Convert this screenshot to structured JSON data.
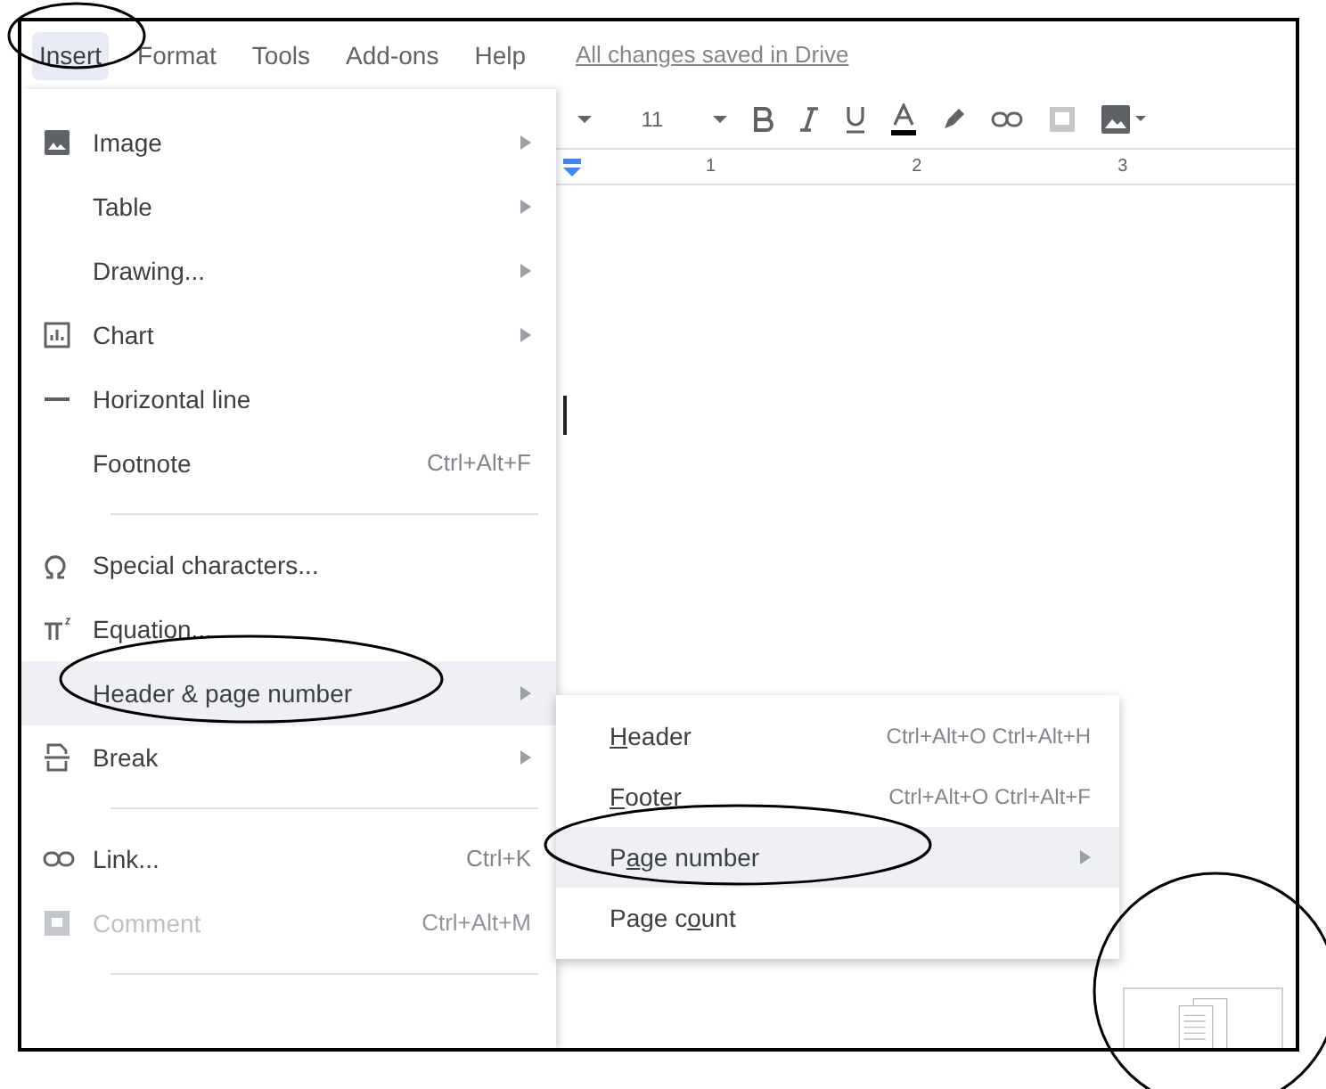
{
  "menubar": {
    "items": [
      {
        "label": "Insert",
        "selected": true
      },
      {
        "label": "Format",
        "selected": false
      },
      {
        "label": "Tools",
        "selected": false
      },
      {
        "label": "Add-ons",
        "selected": false
      },
      {
        "label": "Help",
        "selected": false
      }
    ],
    "status": "All changes saved in Drive"
  },
  "toolbar": {
    "font_size": "11"
  },
  "ruler": {
    "marks": [
      "1",
      "2",
      "3"
    ]
  },
  "insert_menu": [
    {
      "kind": "image",
      "label": "Image",
      "submenu": true,
      "selected": false,
      "disabled": false
    },
    {
      "kind": "plain",
      "label": "Table",
      "submenu": true,
      "selected": false,
      "disabled": false
    },
    {
      "kind": "plain",
      "label": "Drawing...",
      "submenu": true,
      "selected": false,
      "disabled": false
    },
    {
      "kind": "chart",
      "label": "Chart",
      "submenu": true,
      "selected": false,
      "disabled": false
    },
    {
      "kind": "line",
      "label": "Horizontal line",
      "submenu": false,
      "selected": false,
      "disabled": false
    },
    {
      "kind": "plain",
      "label": "Footnote",
      "shortcut": "Ctrl+Alt+F",
      "submenu": false,
      "selected": false,
      "disabled": false
    },
    {
      "kind": "separator"
    },
    {
      "kind": "omega",
      "label": "Special characters...",
      "submenu": false,
      "selected": false,
      "disabled": false
    },
    {
      "kind": "pi",
      "label": "Equation...",
      "submenu": false,
      "selected": false,
      "disabled": false
    },
    {
      "kind": "plain",
      "label": "Header & page number",
      "submenu": true,
      "selected": true,
      "disabled": false
    },
    {
      "kind": "break",
      "label": "Break",
      "submenu": true,
      "selected": false,
      "disabled": false
    },
    {
      "kind": "separator"
    },
    {
      "kind": "link",
      "label": "Link...",
      "shortcut": "Ctrl+K",
      "submenu": false,
      "selected": false,
      "disabled": false
    },
    {
      "kind": "comment",
      "label": "Comment",
      "shortcut": "Ctrl+Alt+M",
      "submenu": false,
      "selected": false,
      "disabled": true
    },
    {
      "kind": "separator"
    }
  ],
  "header_submenu": [
    {
      "mnemonic": "H",
      "after": "eader",
      "shortcut": "Ctrl+Alt+O Ctrl+Alt+H",
      "submenu": false,
      "selected": false
    },
    {
      "mnemonic": "F",
      "after": "ooter",
      "shortcut": "Ctrl+Alt+O Ctrl+Alt+F",
      "submenu": false,
      "selected": false
    },
    {
      "before": "P",
      "mnemonic": "a",
      "after": "ge number",
      "submenu": true,
      "selected": true
    },
    {
      "before": "Page c",
      "mnemonic": "o",
      "after": "unt",
      "submenu": false,
      "selected": false
    }
  ]
}
